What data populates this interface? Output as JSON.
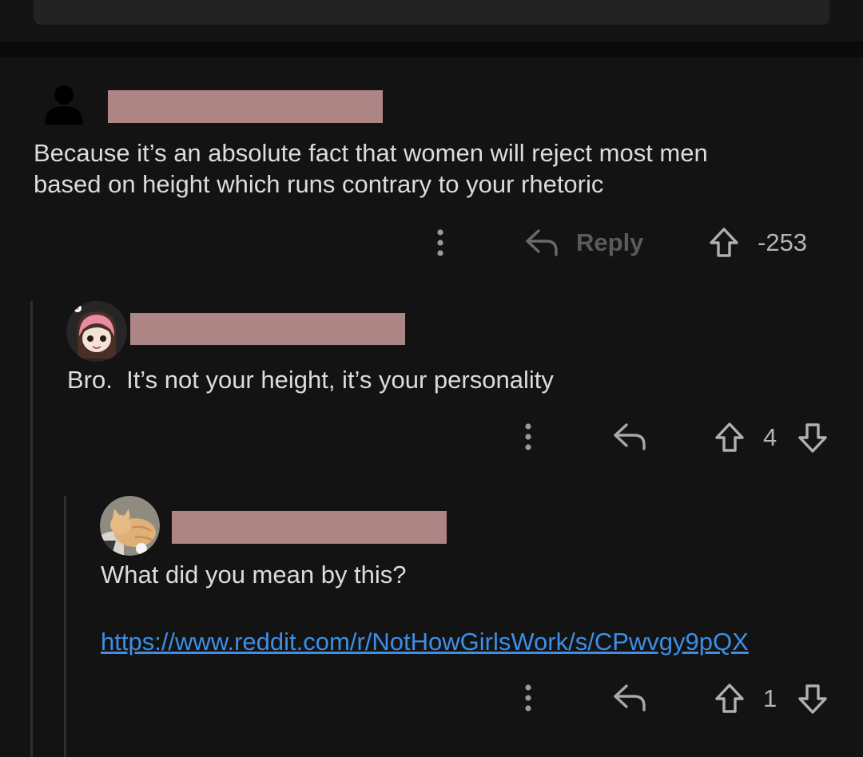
{
  "comments": [
    {
      "text_lines": [
        "Because it’s an absolute fact that women will reject most men",
        "based on height which runs contrary to your rhetoric"
      ],
      "actions": {
        "reply_label": "Reply",
        "score": "-253"
      },
      "avatar_icon": "user-silhouette-icon"
    },
    {
      "text": "Bro.  It’s not your height, it’s your personality",
      "actions": {
        "score": "4"
      },
      "avatar_icon": "anime-avatar-icon"
    },
    {
      "text": "What did you mean by this?",
      "link": "https://www.reddit.com/r/NotHowGirlsWork/s/CPwvgy9pQX",
      "actions": {
        "score": "1"
      },
      "avatar_icon": "cat-avatar-icon"
    }
  ],
  "colors": {
    "background": "#131313",
    "redaction": "#ad8585",
    "link": "#3d8ee6",
    "text": "#dcdcdc"
  }
}
